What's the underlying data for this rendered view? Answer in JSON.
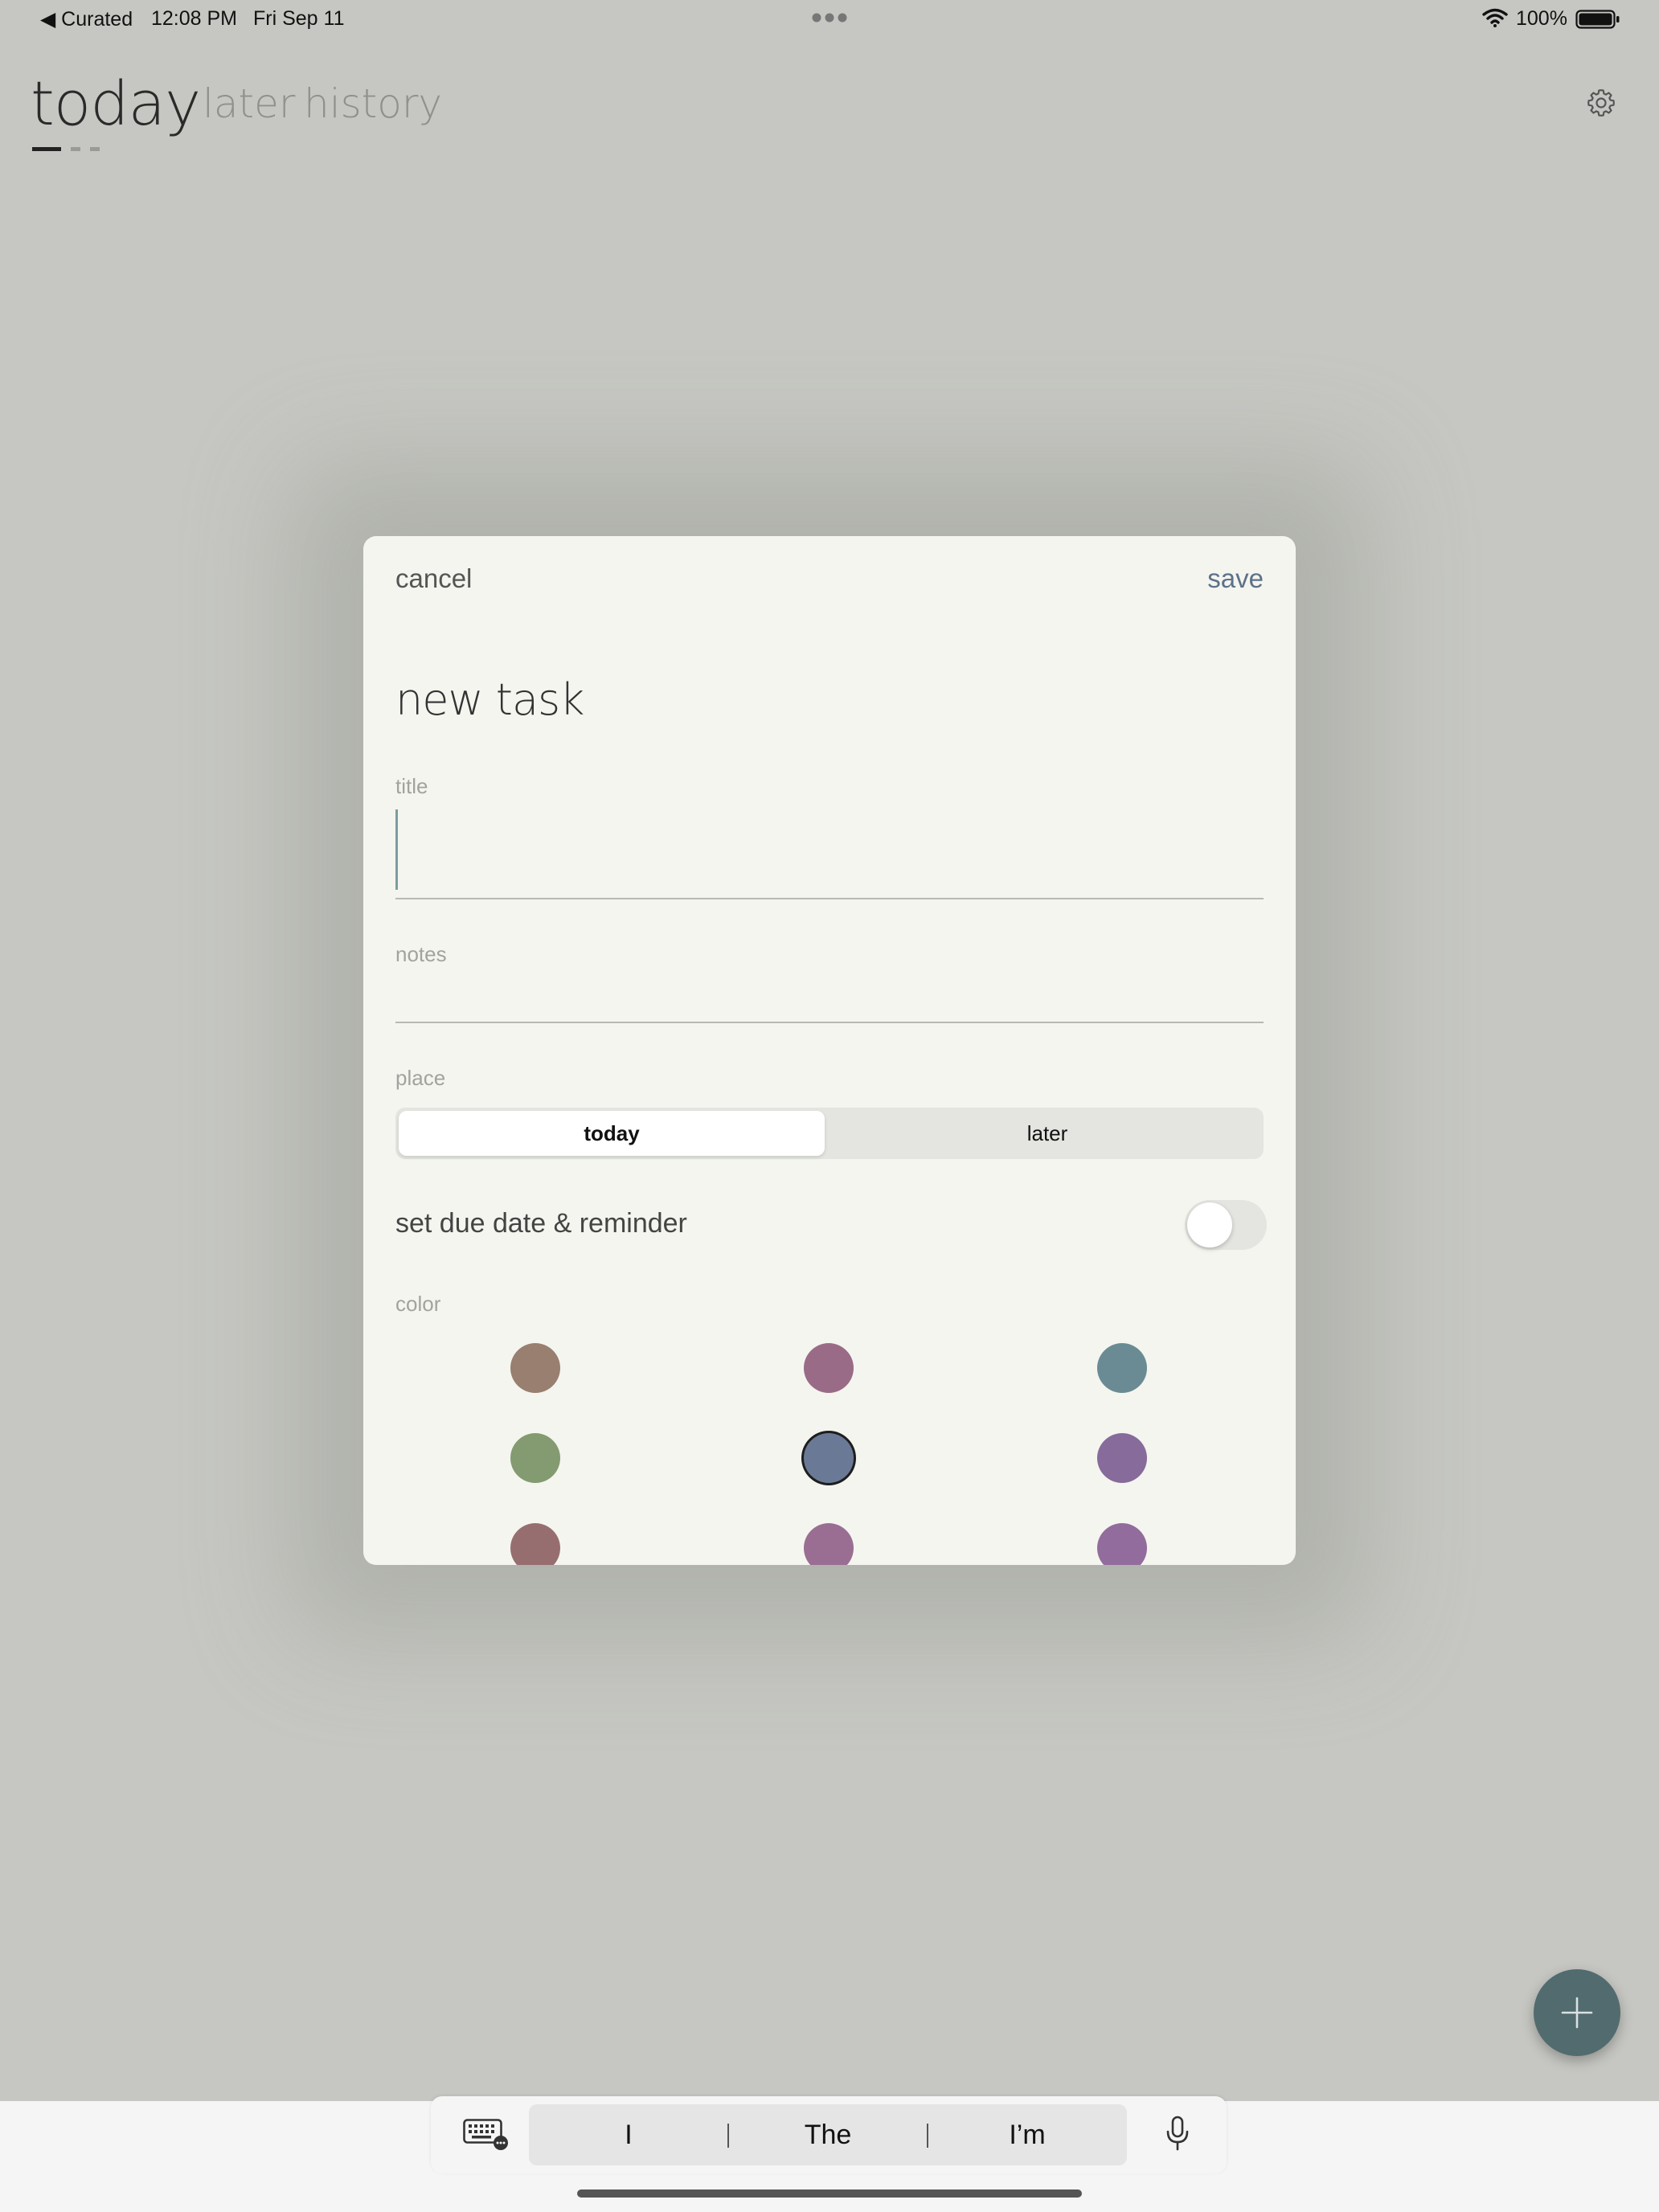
{
  "status_bar": {
    "back_label": "◀ Curated",
    "time": "12:08 PM",
    "date": "Fri Sep 11",
    "battery": "100%"
  },
  "tabs": [
    {
      "label": "today",
      "active": true
    },
    {
      "label": "later",
      "active": false
    },
    {
      "label": "history",
      "active": false
    }
  ],
  "modal": {
    "cancel_label": "cancel",
    "save_label": "save",
    "heading": "new task",
    "title_label": "title",
    "title_value": "",
    "notes_label": "notes",
    "notes_value": "",
    "place_label": "place",
    "place_options": [
      "today",
      "later"
    ],
    "place_selected": "today",
    "due_label": "set due date & reminder",
    "due_enabled": false,
    "color_label": "color",
    "colors": [
      "#987f70",
      "#9a6b87",
      "#6a8b94",
      "#849a70",
      "#6a7a96",
      "#866b9b",
      "#976e70",
      "#9a6e93",
      "#916c9c"
    ],
    "selected_color_index": 4
  },
  "keyboard_bar": {
    "suggestions": [
      "I",
      "The",
      "I’m"
    ]
  },
  "theme": {
    "accent_save": "#5d7189",
    "fab_color": "#526b6f"
  }
}
